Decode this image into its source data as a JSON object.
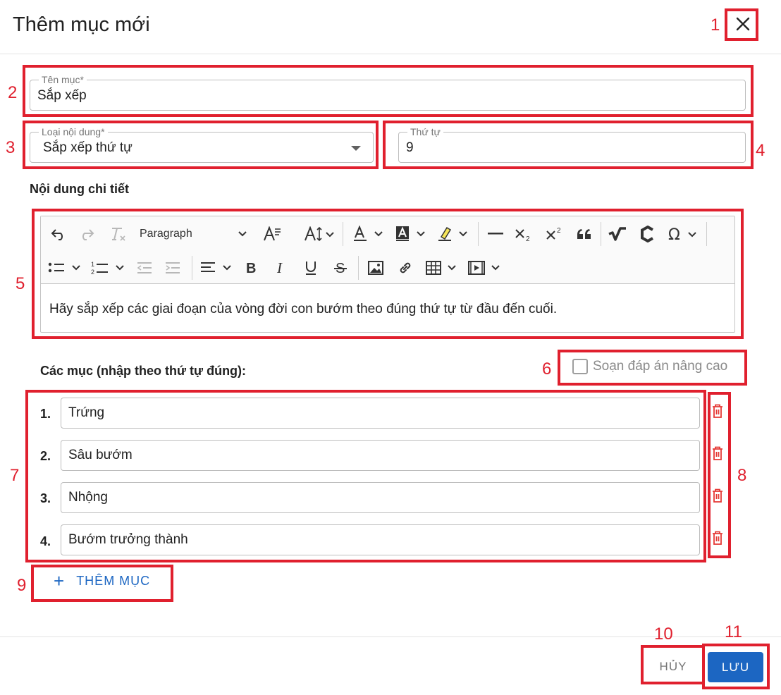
{
  "dialog": {
    "title": "Thêm mục mới",
    "close_icon": "close-icon"
  },
  "name_field": {
    "label": "Tên mục*",
    "value": "Sắp xếp"
  },
  "content_type_field": {
    "label": "Loại nội dung*",
    "value": "Sắp xếp thứ tự"
  },
  "order_field": {
    "label": "Thứ tự",
    "value": "9"
  },
  "detail": {
    "title": "Nội dung chi tiết",
    "paragraph_style": "Paragraph",
    "text": "Hãy sắp xếp các giai đoạn của vòng đời con bướm theo đúng thứ tự từ đầu đến cuối."
  },
  "items_section": {
    "title": "Các mục (nhập theo thứ tự đúng):",
    "advanced_label": "Soạn đáp án nâng cao",
    "advanced_checked": false,
    "items": [
      {
        "number": "1.",
        "value": "Trứng"
      },
      {
        "number": "2.",
        "value": "Sâu bướm"
      },
      {
        "number": "3.",
        "value": "Nhộng"
      },
      {
        "number": "4.",
        "value": "Bướm trưởng thành"
      }
    ],
    "add_label": "THÊM MỤC"
  },
  "footer": {
    "cancel_label": "HỦY",
    "save_label": "LƯU"
  },
  "annotations": [
    "1",
    "2",
    "3",
    "4",
    "5",
    "6",
    "7",
    "8",
    "9",
    "10",
    "11"
  ],
  "colors": {
    "primary": "#1c66c2",
    "annotation": "#e0202e",
    "delete": "#e53935"
  }
}
